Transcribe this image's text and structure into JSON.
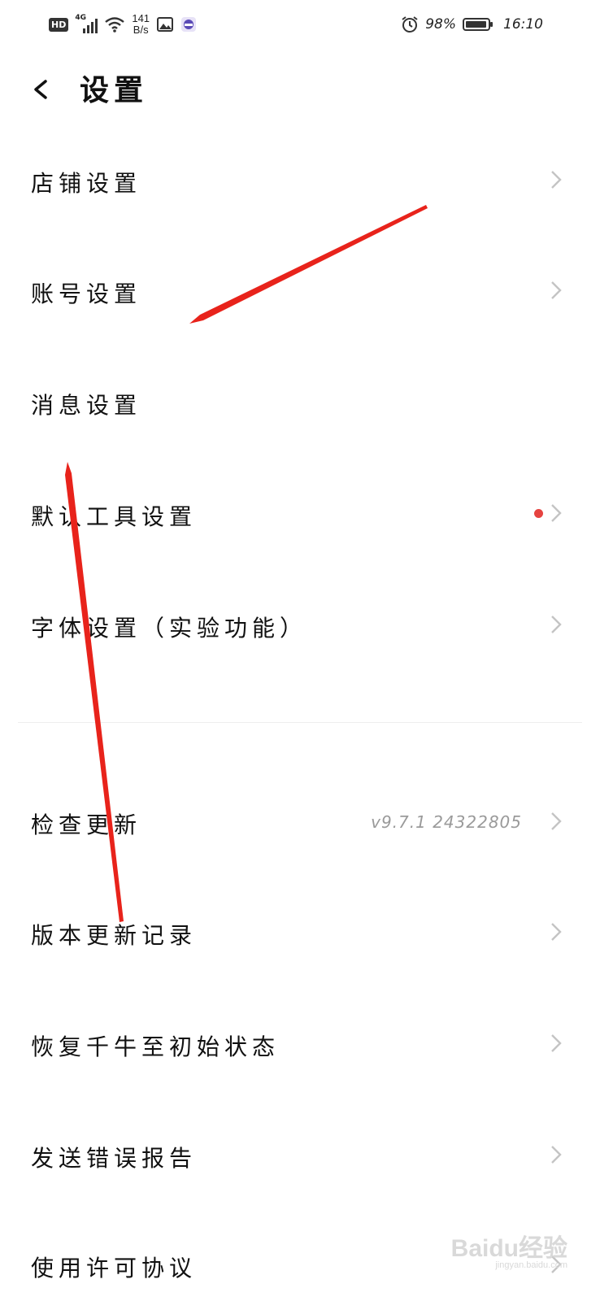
{
  "status_bar": {
    "hd": "HD",
    "network": "4G",
    "speed_value": "141",
    "speed_unit": "B/s",
    "battery": "98%",
    "battery_level": 0.98,
    "time": "16:10"
  },
  "header": {
    "title": "设置"
  },
  "menu": {
    "group1": [
      {
        "label": "店铺设置"
      },
      {
        "label": "账号设置"
      },
      {
        "label": "消息设置"
      },
      {
        "label": "默认工具设置",
        "badge": true
      },
      {
        "label": "字体设置（实验功能）"
      }
    ],
    "group2": [
      {
        "label": "检查更新",
        "value": "v9.7.1 24322805"
      },
      {
        "label": "版本更新记录"
      },
      {
        "label": "恢复千牛至初始状态"
      },
      {
        "label": "发送错误报告"
      },
      {
        "label": "使用许可协议"
      }
    ]
  },
  "watermark": {
    "brand": "Baidu经验",
    "url": "jingyan.baidu.com"
  },
  "colors": {
    "badge": "#e64340",
    "chevron": "#c4c4c4",
    "annotation": "#e8231b"
  }
}
